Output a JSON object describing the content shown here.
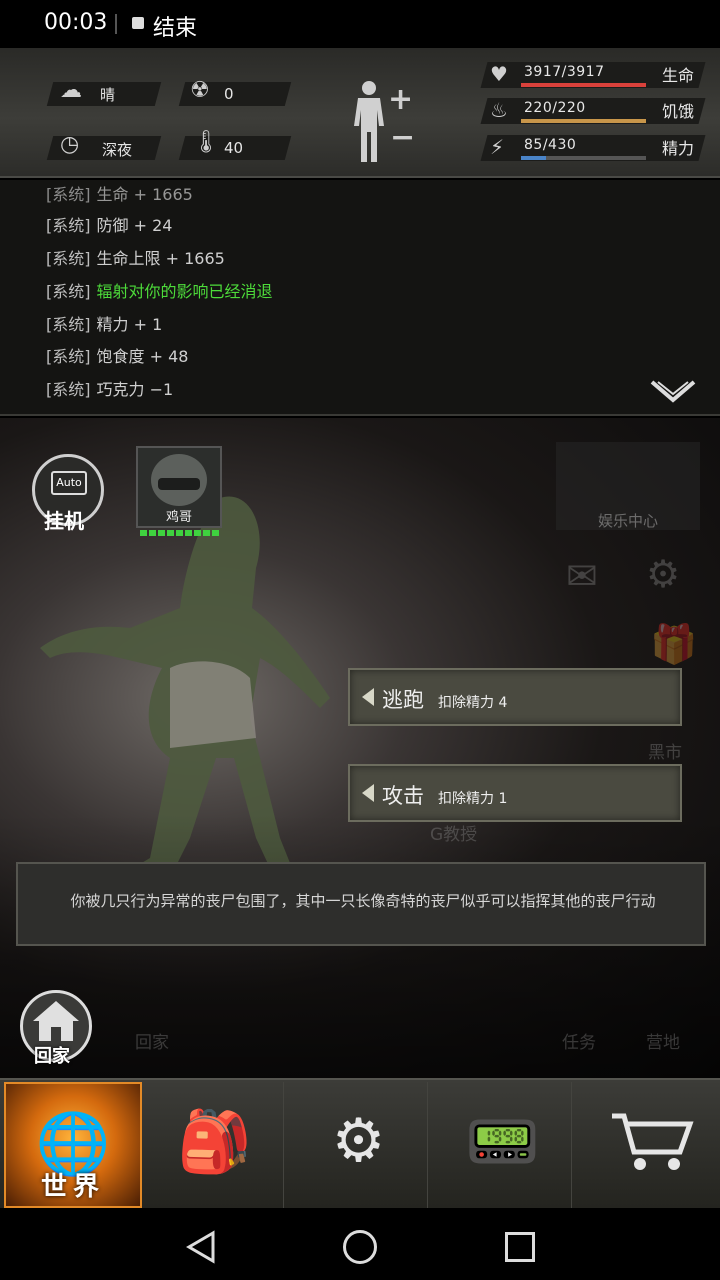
{
  "status_bar": {
    "time": "00:03",
    "end_label": "结束"
  },
  "hud": {
    "weather": {
      "icon": "cloud-sun-icon",
      "value": "晴"
    },
    "radiation": {
      "icon": "radiation-icon",
      "value": "0"
    },
    "time_of_day": {
      "icon": "clock-icon",
      "value": "深夜"
    },
    "temperature": {
      "icon": "thermometer-icon",
      "value": "40"
    },
    "stats": [
      {
        "icon": "heart-icon",
        "value": "3917/3917",
        "label": "生命",
        "fraction": 1.0,
        "color": "#d9413b"
      },
      {
        "icon": "stomach-icon",
        "value": "220/220",
        "label": "饥饿",
        "fraction": 1.0,
        "color": "#c8964a"
      },
      {
        "icon": "energy-icon",
        "value": "85/430",
        "label": "精力",
        "fraction": 0.198,
        "color": "#4a84c8"
      }
    ]
  },
  "log": {
    "lines": [
      {
        "tag": "[系统]",
        "msg": "生命 + 1665",
        "green": false
      },
      {
        "tag": "[系统]",
        "msg": "防御 + 24",
        "green": false
      },
      {
        "tag": "[系统]",
        "msg": "生命上限 + 1665",
        "green": false
      },
      {
        "tag": "[系统]",
        "msg": "辐射对你的影响已经消退",
        "green": true
      },
      {
        "tag": "[系统]",
        "msg": "精力 + 1",
        "green": false
      },
      {
        "tag": "[系统]",
        "msg": "饱食度 + 48",
        "green": false
      },
      {
        "tag": "[系统]",
        "msg": "巧克力 −1",
        "green": false
      }
    ]
  },
  "scene": {
    "auto_badge": "Auto",
    "auto_label": "挂机",
    "enemy_name": "鸡哥",
    "entertainment_label": "娱乐中心",
    "black_market_label": "黑市",
    "professor_label": "G教授",
    "actions": [
      {
        "title": "逃跑",
        "cost": "扣除精力 4"
      },
      {
        "title": "攻击",
        "cost": "扣除精力 1"
      }
    ],
    "description": "你被几只行为异常的丧尸包围了，其中一只长像奇特的丧尸似乎可以指挥其他的丧尸行动",
    "home_label": "回家",
    "faint_home_label": "回家",
    "task_label": "任务",
    "camp_label": "营地"
  },
  "tabs": [
    {
      "name": "world",
      "label": "世界",
      "icon": "globe-icon",
      "active": true
    },
    {
      "name": "backpack",
      "label": "",
      "icon": "backpack-icon",
      "active": false
    },
    {
      "name": "skills",
      "label": "",
      "icon": "head-gears-icon",
      "active": false
    },
    {
      "name": "radio",
      "label": "",
      "icon": "walkie-talkie-icon",
      "active": false
    },
    {
      "name": "shop",
      "label": "",
      "icon": "cart-icon",
      "active": false
    }
  ]
}
